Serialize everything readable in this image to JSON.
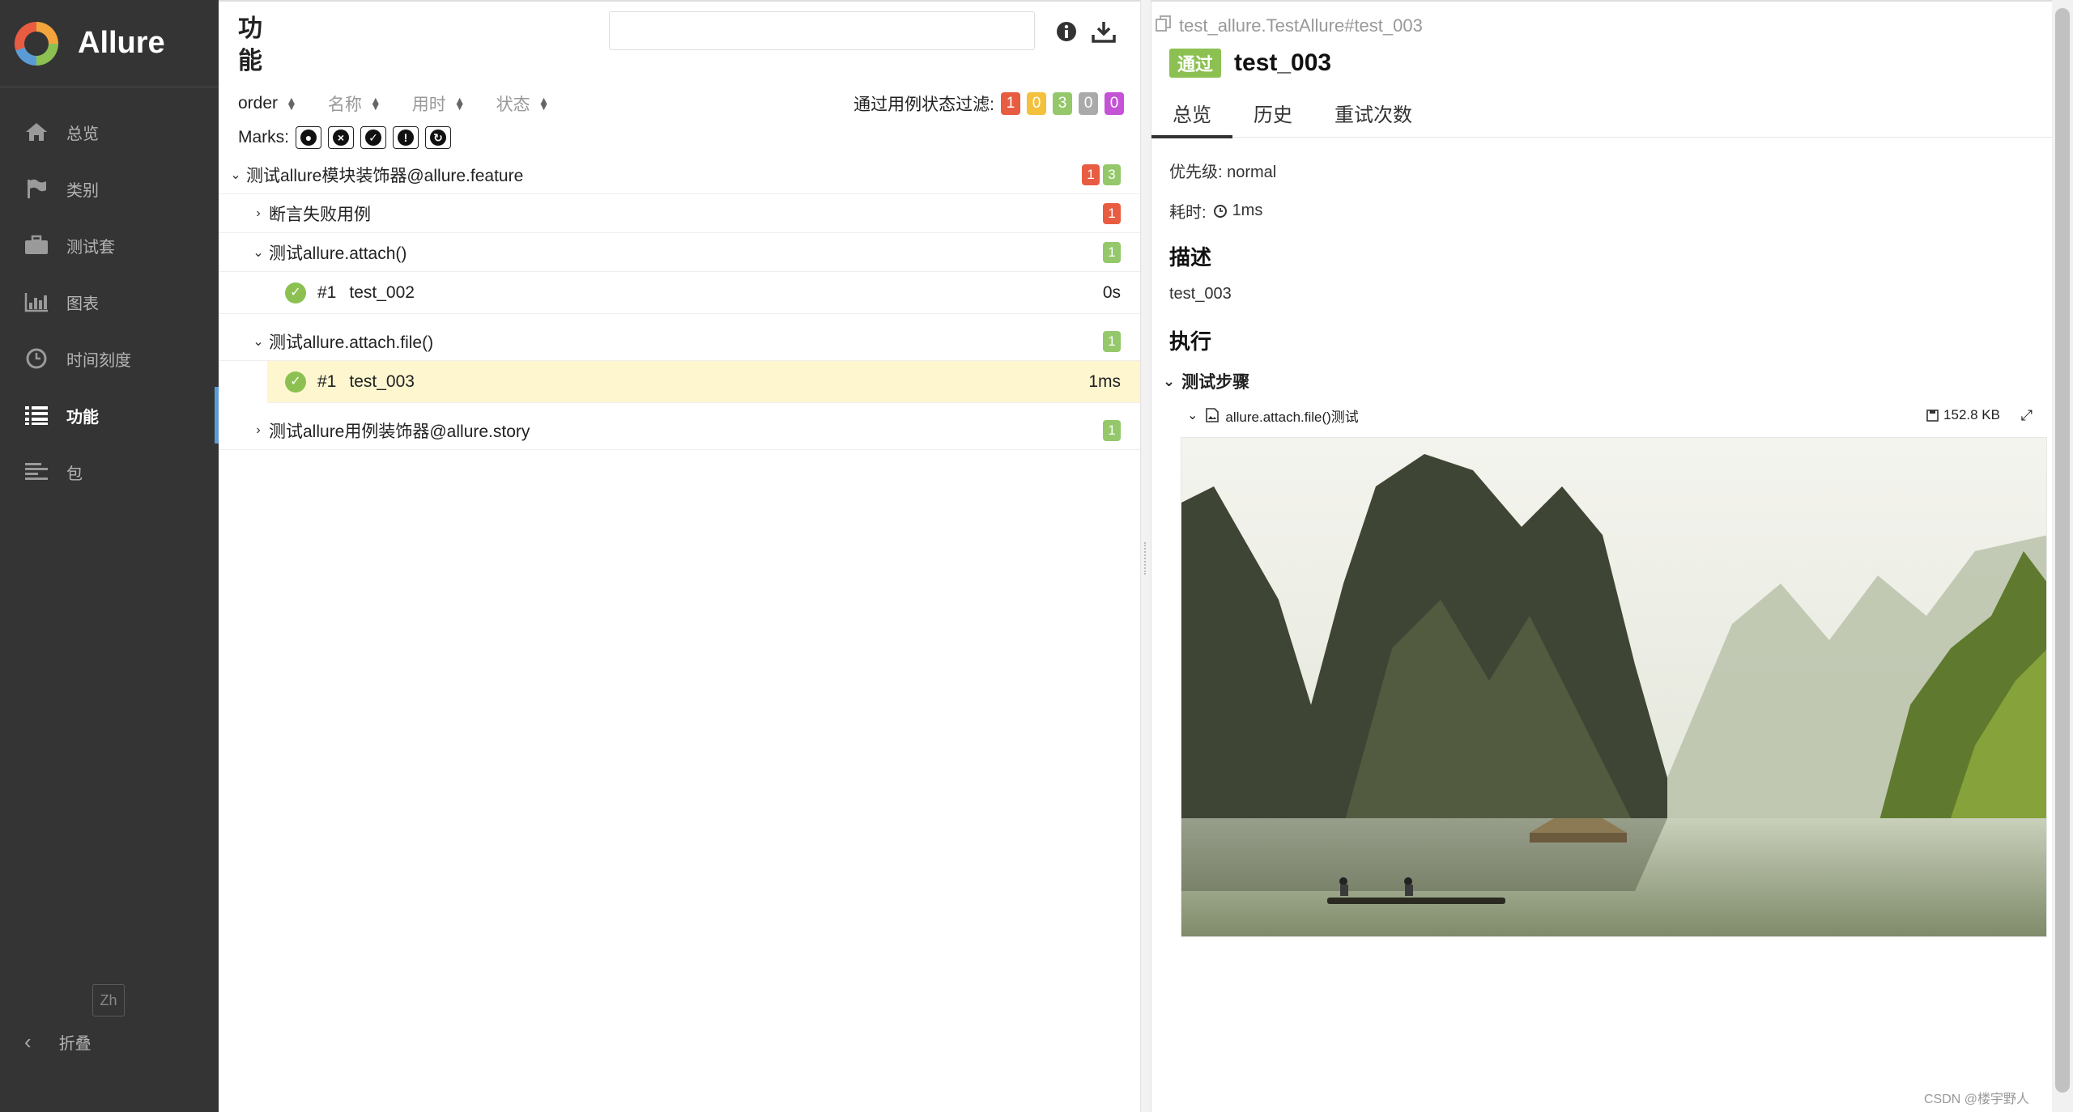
{
  "app": {
    "title": "Allure"
  },
  "sidebar": {
    "items": [
      {
        "label": "总览",
        "icon": "home-icon"
      },
      {
        "label": "类别",
        "icon": "flag-icon"
      },
      {
        "label": "测试套",
        "icon": "briefcase-icon"
      },
      {
        "label": "图表",
        "icon": "bar-chart-icon"
      },
      {
        "label": "时间刻度",
        "icon": "clock-icon"
      },
      {
        "label": "功能",
        "icon": "list-icon",
        "active": true
      },
      {
        "label": "包",
        "icon": "align-left-icon"
      }
    ],
    "lang": "Zh",
    "collapse_label": "折叠"
  },
  "middle": {
    "title": "功能",
    "search_placeholder": "",
    "sort": [
      "order",
      "名称",
      "用时",
      "状态"
    ],
    "filter_label": "通过用例状态过滤:",
    "filter_counts": [
      "1",
      "0",
      "3",
      "0",
      "0"
    ],
    "marks_label": "Marks:",
    "tree": {
      "feature": {
        "label": "测试allure模块装饰器@allure.feature",
        "failed": "1",
        "passed": "3"
      },
      "groups": [
        {
          "label": "断言失败用例",
          "count": "1",
          "color": "#e85c41",
          "expanded": false
        },
        {
          "label": "测试allure.attach()",
          "count": "1",
          "color": "#94c86b",
          "expanded": true,
          "leaf": {
            "num": "#1",
            "name": "test_002",
            "duration": "0s"
          }
        },
        {
          "label": "测试allure.attach.file()",
          "count": "1",
          "color": "#94c86b",
          "expanded": true,
          "leaf": {
            "num": "#1",
            "name": "test_003",
            "duration": "1ms"
          }
        },
        {
          "label": "测试allure用例装饰器@allure.story",
          "count": "1",
          "color": "#94c86b",
          "expanded": false
        }
      ]
    }
  },
  "right": {
    "path": "test_allure.TestAllure#test_003",
    "status": "通过",
    "title": "test_003",
    "tabs": [
      "总览",
      "历史",
      "重试次数"
    ],
    "priority": "优先级: normal",
    "duration_label": "耗时:",
    "duration": "1ms",
    "desc_heading": "描述",
    "desc": "test_003",
    "exec_heading": "执行",
    "steps_label": "测试步骤",
    "attachment_name": "allure.attach.file()测试",
    "attachment_size": "152.8 KB"
  },
  "colors": {
    "sidebar_bg": "#343434",
    "passed": "#8cc152",
    "failed": "#e85c41",
    "accent": "#5a9bd5",
    "selected_row": "#fdf6cf"
  },
  "watermark": "CSDN @楼宇野人"
}
